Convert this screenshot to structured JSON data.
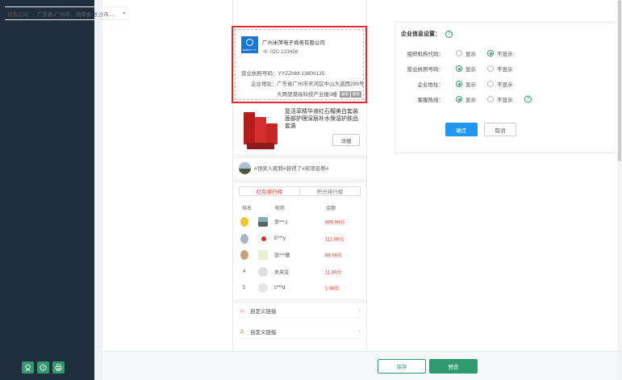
{
  "colors": {
    "accent": "#2e9a6e",
    "danger": "#e53935",
    "primary": "#2196f3",
    "sidebar": "#1f2d3d"
  },
  "sidebar": {
    "icons": [
      "user-icon",
      "help-icon",
      "printer-icon"
    ]
  },
  "sale_area": {
    "label": "销售区域",
    "value": "广东省-广州市、湖南省-长沙市..."
  },
  "company": {
    "logo_text": "mebo+++",
    "name": "广州米萍电子商务有限公司",
    "phone": "020-123456",
    "license": "营业执照号码：YYZZHM-13800135",
    "address_label": "企业地址：",
    "address": "广东省广州市天河区中山大道西299号大两塑港高科技产业楼3楼",
    "tags": [
      "编辑",
      "删除"
    ]
  },
  "product": {
    "title": "复活草精华液红石榴美白套装面部护理深层补水保湿护肤品套装",
    "detail_button": "详细"
  },
  "winner_banner": "#领奖人昵称#获得了#奖项名称#",
  "ranking": {
    "tabs": [
      "红包排行榜",
      "积分排行榜"
    ],
    "headers": [
      "排名",
      "昵称",
      "金额"
    ],
    "rows": [
      {
        "rank": "1",
        "name": "李***J",
        "amount": "999.99元"
      },
      {
        "rank": "2",
        "name": "E***y",
        "amount": "111.99元"
      },
      {
        "rank": "3",
        "name": "张***珊",
        "amount": "99.99元"
      },
      {
        "rank": "4",
        "name": "未关注",
        "amount": "11.99元"
      },
      {
        "rank": "5",
        "name": "c***d",
        "amount": "1.99元"
      }
    ]
  },
  "custom_links": [
    "自定义链接",
    "自定义链接"
  ],
  "settings_panel": {
    "title": "企业信息设置：",
    "options": {
      "show": "显示",
      "hide": "不显示"
    },
    "rows": [
      {
        "label": "组织机构代码：",
        "value": "hide"
      },
      {
        "label": "营业执照号码：",
        "value": "show"
      },
      {
        "label": "企业地址：",
        "value": "show"
      },
      {
        "label": "客服热线：",
        "value": "show"
      }
    ],
    "confirm": "确定",
    "cancel": "取消"
  },
  "footer": {
    "save": "保存",
    "preview": "预览"
  }
}
